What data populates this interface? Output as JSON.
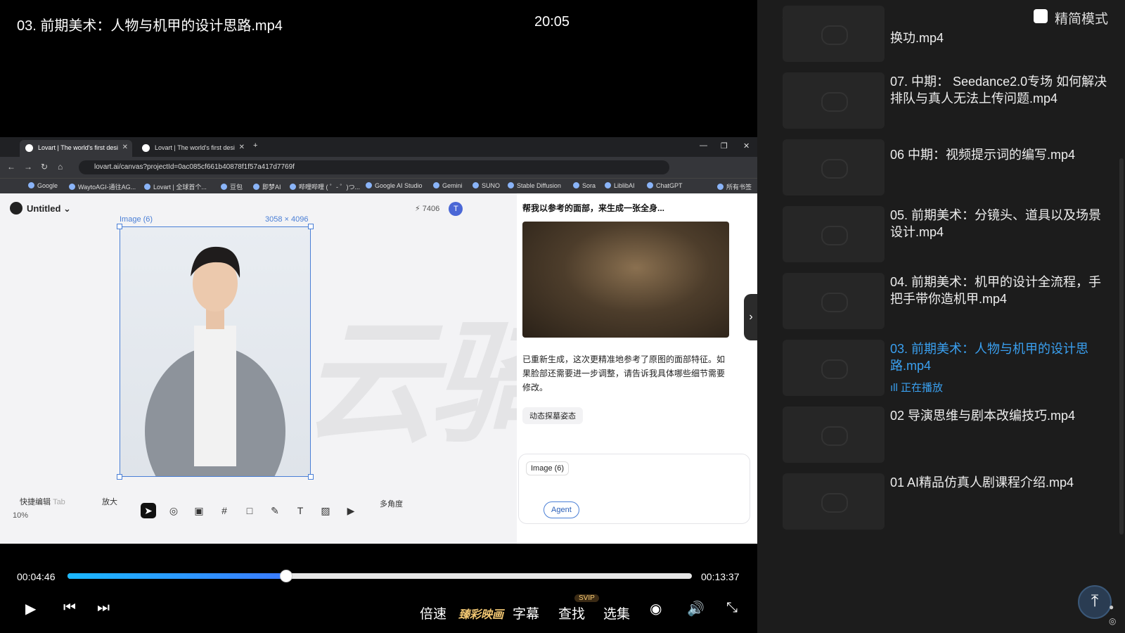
{
  "player": {
    "title": "03. 前期美术：人物与机甲的设计思路.mp4",
    "clock": "20:05",
    "current_time": "00:04:46",
    "total_time": "00:13:37",
    "progress": 0.35,
    "controls": {
      "speed": "倍速",
      "hdr": "臻彩映画",
      "subtitle": "字幕",
      "search": "查找",
      "search_badge": "SVIP",
      "episodes": "选集"
    }
  },
  "browser": {
    "tabs": [
      "Lovart | The world's first desi",
      "Lovart | The world's first desi"
    ],
    "url": "lovart.ai/canvas?projectId=0ac085cf661b40878f1f57a417d7769f",
    "bookmarks": [
      "Google",
      "WaytoAGI-通往AG...",
      "Lovart | 全球首个...",
      "豆包",
      "即梦AI",
      "哔哩哔哩 ( ゜- ゜)つ...",
      "Google AI Studio",
      "Gemini",
      "SUNO",
      "Stable Diffusion",
      "Sora",
      "LiblibAI",
      "ChatGPT",
      "所有书签"
    ]
  },
  "canvas": {
    "project_name": "Untitled",
    "image_label": "Image (6)",
    "image_size": "3058 × 4096",
    "credits": "7406",
    "avatar_letter": "T",
    "watermark": "云骑AI",
    "quick_edit": "快捷编辑",
    "quick_edit_shortcut": "Tab",
    "enlarge": "放大",
    "multi_angle": "多角度",
    "zoom": "10%"
  },
  "chat": {
    "title": "帮我以参考的面部，来生成一张全身...",
    "message": "已重新生成，这次更精准地参考了原图的面部特征。如果脸部还需要进一步调整，请告诉我具体哪些细节需要修改。",
    "chip": "动态探墓姿态",
    "input_tag": "Image (6)",
    "agent_label": "Agent"
  },
  "sidebar": {
    "back_label": "选集",
    "mode_label": "精简模式",
    "now_playing": "正在播放",
    "episodes": [
      {
        "label": "换功.mp4",
        "active": false
      },
      {
        "label": "07. 中期： Seedance2.0专场 如何解决排队与真人无法上传问题.mp4",
        "active": false
      },
      {
        "label": "06 中期：视频提示词的编写.mp4",
        "active": false
      },
      {
        "label": "05. 前期美术：分镜头、道具以及场景设计.mp4",
        "active": false
      },
      {
        "label": "04. 前期美术：机甲的设计全流程，手把手带你造机甲.mp4",
        "active": false
      },
      {
        "label": "03. 前期美术：人物与机甲的设计思路.mp4",
        "active": true
      },
      {
        "label": "02 导演思维与剧本改编技巧.mp4",
        "active": false
      },
      {
        "label": "01 AI精品仿真人剧课程介绍.mp4",
        "active": false
      }
    ]
  }
}
